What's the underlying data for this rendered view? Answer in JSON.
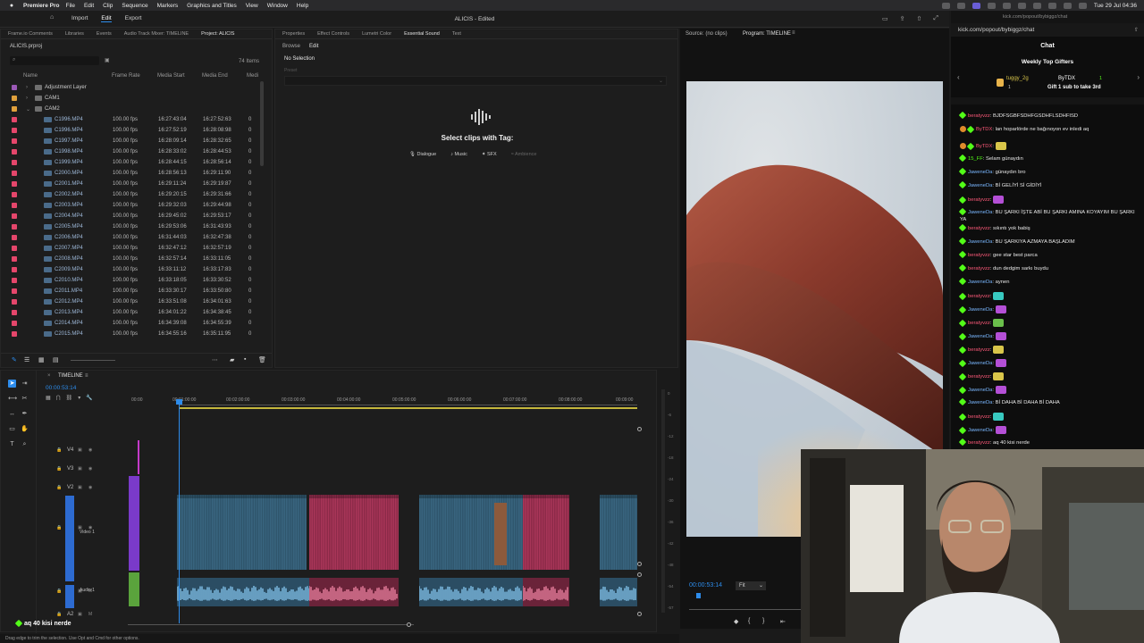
{
  "menubar": {
    "app": "Premiere Pro",
    "items": [
      "File",
      "Edit",
      "Clip",
      "Sequence",
      "Markers",
      "Graphics and Titles",
      "View",
      "Window",
      "Help"
    ],
    "clock": "Tue 29 Jul  04:36"
  },
  "premiere": {
    "nav": [
      "Import",
      "Edit",
      "Export"
    ],
    "active_nav": "Edit",
    "title": "ALICIS - Edited",
    "panel_tabs": [
      "Frame.io Comments",
      "Libraries",
      "Events",
      "Audio Track Mixer: TIMELINE",
      "Project: ALICIS"
    ],
    "project": {
      "file": "ALICIS.prproj",
      "items_count": "74 Items",
      "columns": {
        "name": "Name",
        "frame_rate": "Frame Rate",
        "media_start": "Media Start",
        "media_end": "Media End",
        "media": "Medi"
      },
      "folders": [
        {
          "name": "Adjustment Layer",
          "color": "#9b59b6"
        },
        {
          "name": "CAM1",
          "color": "#e0a03c"
        },
        {
          "name": "CAM2",
          "color": "#e0a03c"
        }
      ],
      "clips": [
        {
          "name": "C1996.MP4",
          "fps": "100.00 fps",
          "start": "16:27:43:04",
          "end": "16:27:52:63",
          "v": "0"
        },
        {
          "name": "C1996.MP4",
          "fps": "100.00 fps",
          "start": "16:27:52:19",
          "end": "16:28:08:98",
          "v": "0"
        },
        {
          "name": "C1997.MP4",
          "fps": "100.00 fps",
          "start": "16:28:09:14",
          "end": "16:28:32:65",
          "v": "0"
        },
        {
          "name": "C1998.MP4",
          "fps": "100.00 fps",
          "start": "16:28:33:02",
          "end": "16:28:44:53",
          "v": "0"
        },
        {
          "name": "C1999.MP4",
          "fps": "100.00 fps",
          "start": "16:28:44:15",
          "end": "16:28:56:14",
          "v": "0"
        },
        {
          "name": "C2000.MP4",
          "fps": "100.00 fps",
          "start": "16:28:56:13",
          "end": "16:29:11:90",
          "v": "0"
        },
        {
          "name": "C2001.MP4",
          "fps": "100.00 fps",
          "start": "16:29:11:24",
          "end": "16:29:19:87",
          "v": "0"
        },
        {
          "name": "C2002.MP4",
          "fps": "100.00 fps",
          "start": "16:29:20:15",
          "end": "16:29:31:66",
          "v": "0"
        },
        {
          "name": "C2003.MP4",
          "fps": "100.00 fps",
          "start": "16:29:32:03",
          "end": "16:29:44:98",
          "v": "0"
        },
        {
          "name": "C2004.MP4",
          "fps": "100.00 fps",
          "start": "16:29:45:02",
          "end": "16:29:53:17",
          "v": "0"
        },
        {
          "name": "C2005.MP4",
          "fps": "100.00 fps",
          "start": "16:29:53:06",
          "end": "16:31:43:93",
          "v": "0"
        },
        {
          "name": "C2006.MP4",
          "fps": "100.00 fps",
          "start": "16:31:44:03",
          "end": "16:32:47:38",
          "v": "0"
        },
        {
          "name": "C2007.MP4",
          "fps": "100.00 fps",
          "start": "16:32:47:12",
          "end": "16:32:57:19",
          "v": "0"
        },
        {
          "name": "C2008.MP4",
          "fps": "100.00 fps",
          "start": "16:32:57:14",
          "end": "16:33:11:05",
          "v": "0"
        },
        {
          "name": "C2009.MP4",
          "fps": "100.00 fps",
          "start": "16:33:11:12",
          "end": "16:33:17:83",
          "v": "0"
        },
        {
          "name": "C2010.MP4",
          "fps": "100.00 fps",
          "start": "16:33:18:05",
          "end": "16:33:30:52",
          "v": "0"
        },
        {
          "name": "C2011.MP4",
          "fps": "100.00 fps",
          "start": "16:33:30:17",
          "end": "16:33:50:80",
          "v": "0"
        },
        {
          "name": "C2012.MP4",
          "fps": "100.00 fps",
          "start": "16:33:51:08",
          "end": "16:34:01:63",
          "v": "0"
        },
        {
          "name": "C2013.MP4",
          "fps": "100.00 fps",
          "start": "16:34:01:22",
          "end": "16:34:38:45",
          "v": "0"
        },
        {
          "name": "C2014.MP4",
          "fps": "100.00 fps",
          "start": "16:34:39:08",
          "end": "16:34:55:39",
          "v": "0"
        },
        {
          "name": "C2015.MP4",
          "fps": "100.00 fps",
          "start": "16:34:55:16",
          "end": "16:35:11:95",
          "v": "0"
        }
      ]
    },
    "essential": {
      "tabs": [
        "Properties",
        "Effect Controls",
        "Lumetri Color",
        "Essential Sound",
        "Text"
      ],
      "sub_tabs": [
        "Browse",
        "Edit"
      ],
      "no_selection": "No Selection",
      "preset_label": "Preset",
      "message": "Select clips with Tag:",
      "tags": [
        "Dialogue",
        "Music",
        "SFX",
        "Ambience"
      ]
    },
    "program": {
      "source_tab": "Source: (no clips)",
      "program_tab": "Program: TIMELINE",
      "timecode": "00:00:53:14",
      "fit": "Fit"
    },
    "timeline": {
      "tab": "TIMELINE",
      "timecode": "00:00:53:14",
      "ruler": [
        "00:00",
        "00:01:00:00",
        "00:02:00:00",
        "00:03:00:00",
        "00:04:00:00",
        "00:05:00:00",
        "00:06:00:00",
        "00:07:00:00",
        "00:08:00:00",
        "00:09:00"
      ],
      "tracks": [
        "V4",
        "V3",
        "V2",
        "V1",
        "A1",
        "A2"
      ],
      "v1_name": "Video 1",
      "a1_name": "Audio 1",
      "meter_labels": [
        "0",
        "-6",
        "-12",
        "-18",
        "-24",
        "-30",
        "-36",
        "-42",
        "-48",
        "-54",
        "-57"
      ]
    },
    "status": "Drag edge to trim the selection. Use Opt and Cmd for other options."
  },
  "chat": {
    "url": "kick.com/popout/bybiggz/chat",
    "bar": "kick.com/popout/bybiggz/chat",
    "title": "Chat",
    "gifters_title": "Weekly Top Gifters",
    "gifter1": {
      "name": "tuggy_2g",
      "count": "1"
    },
    "gifter2": {
      "name": "ByTDX",
      "count": "1",
      "cta": "Gift 1 sub to take 3rd"
    },
    "messages": [
      {
        "user": "beratyvzz",
        "text": "BJDFSGBFSDHFGSDHFLSDHFISD",
        "color": "red"
      },
      {
        "user": "ByTDX",
        "text": "lan hoparlörde ne bağınoyon ev inledi aq",
        "color": "red"
      },
      {
        "user": "ByTDX",
        "text": "",
        "color": "red"
      },
      {
        "user": "15_FF",
        "text": "Selam günaydın",
        "color": "green"
      },
      {
        "user": "JaweneDa",
        "text": "günaydın bro",
        "color": "blue"
      },
      {
        "user": "JaweneDa",
        "text": "Bİ GELİYİ Sİ GİDİYİ",
        "color": "blue"
      },
      {
        "user": "beratyvzz",
        "text": "",
        "color": "red"
      },
      {
        "user": "JaweneDa",
        "text": "BU ŞARKI İŞTE ABİ BU ŞARKI AMINA KOYAYIM BU ŞARKI YA",
        "color": "blue"
      },
      {
        "user": "beratyvzz",
        "text": "sıkıntı yok babiş",
        "color": "red"
      },
      {
        "user": "JaweneDa",
        "text": "BU ŞARKIYA AZMAYA BAŞLADIM",
        "color": "blue"
      },
      {
        "user": "beratyvzz",
        "text": "gee star best parca",
        "color": "red"
      },
      {
        "user": "beratyvzz",
        "text": "dun dedgim sarkı buydu",
        "color": "red"
      },
      {
        "user": "JaweneDa",
        "text": "aynen",
        "color": "blue"
      },
      {
        "user": "beratyvzz",
        "text": "",
        "color": "red"
      },
      {
        "user": "JaweneDa",
        "text": "",
        "color": "blue"
      },
      {
        "user": "beratyvzz",
        "text": "",
        "color": "red"
      },
      {
        "user": "JaweneDa",
        "text": "",
        "color": "blue"
      },
      {
        "user": "beratyvzz",
        "text": "",
        "color": "red"
      },
      {
        "user": "JaweneDa",
        "text": "",
        "color": "blue"
      },
      {
        "user": "beratyvzz",
        "text": "",
        "color": "red"
      },
      {
        "user": "JaweneDa",
        "text": "",
        "color": "blue"
      },
      {
        "user": "JaweneDa",
        "text": "Bİ DAHA Bİ DAHA Bİ DAHA",
        "color": "blue"
      },
      {
        "user": "beratyvzz",
        "text": "",
        "color": "red"
      },
      {
        "user": "JaweneDa",
        "text": "",
        "color": "blue"
      },
      {
        "user": "beratyvzz",
        "text": "aq 40 kisi nerde",
        "color": "red"
      }
    ]
  },
  "overlay_message": "aq 40 kisi nerde"
}
